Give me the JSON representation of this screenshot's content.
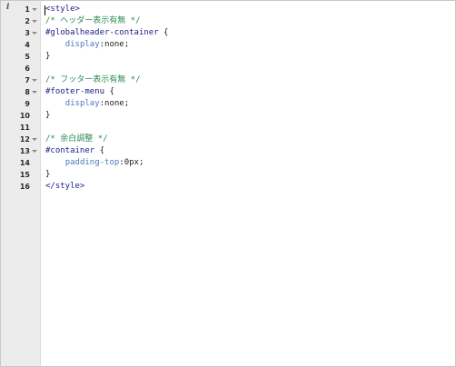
{
  "editor": {
    "info_icon_glyph": "i",
    "line_numbers": [
      "1",
      "2",
      "3",
      "4",
      "5",
      "6",
      "7",
      "8",
      "9",
      "10",
      "11",
      "12",
      "13",
      "14",
      "15",
      "16"
    ],
    "folds": [
      1,
      2,
      3,
      7,
      8,
      12,
      13
    ],
    "lines": [
      {
        "tokens": [
          {
            "t": "<style>",
            "c": "tag"
          }
        ]
      },
      {
        "tokens": [
          {
            "t": "/* ヘッダー表示有無 */",
            "c": "comment"
          }
        ]
      },
      {
        "tokens": [
          {
            "t": "#globalheader-container",
            "c": "selector"
          },
          {
            "t": " {",
            "c": "plain"
          }
        ]
      },
      {
        "tokens": [
          {
            "t": "    ",
            "c": "plain"
          },
          {
            "t": "display",
            "c": "prop"
          },
          {
            "t": ":none;",
            "c": "value"
          }
        ]
      },
      {
        "tokens": [
          {
            "t": "}",
            "c": "plain"
          }
        ]
      },
      {
        "tokens": []
      },
      {
        "tokens": [
          {
            "t": "/* フッター表示有無 */",
            "c": "comment"
          }
        ]
      },
      {
        "tokens": [
          {
            "t": "#footer-menu",
            "c": "selector"
          },
          {
            "t": " {",
            "c": "plain"
          }
        ]
      },
      {
        "tokens": [
          {
            "t": "    ",
            "c": "plain"
          },
          {
            "t": "display",
            "c": "prop"
          },
          {
            "t": ":none;",
            "c": "value"
          }
        ]
      },
      {
        "tokens": [
          {
            "t": "}",
            "c": "plain"
          }
        ]
      },
      {
        "tokens": []
      },
      {
        "tokens": [
          {
            "t": "/* 余白調整 */",
            "c": "comment"
          }
        ]
      },
      {
        "tokens": [
          {
            "t": "#container",
            "c": "selector"
          },
          {
            "t": " {",
            "c": "plain"
          }
        ]
      },
      {
        "tokens": [
          {
            "t": "    ",
            "c": "plain"
          },
          {
            "t": "padding-top",
            "c": "prop"
          },
          {
            "t": ":0px;",
            "c": "value"
          }
        ]
      },
      {
        "tokens": [
          {
            "t": "}",
            "c": "plain"
          }
        ]
      },
      {
        "tokens": [
          {
            "t": "</style>",
            "c": "tag"
          }
        ]
      }
    ]
  }
}
